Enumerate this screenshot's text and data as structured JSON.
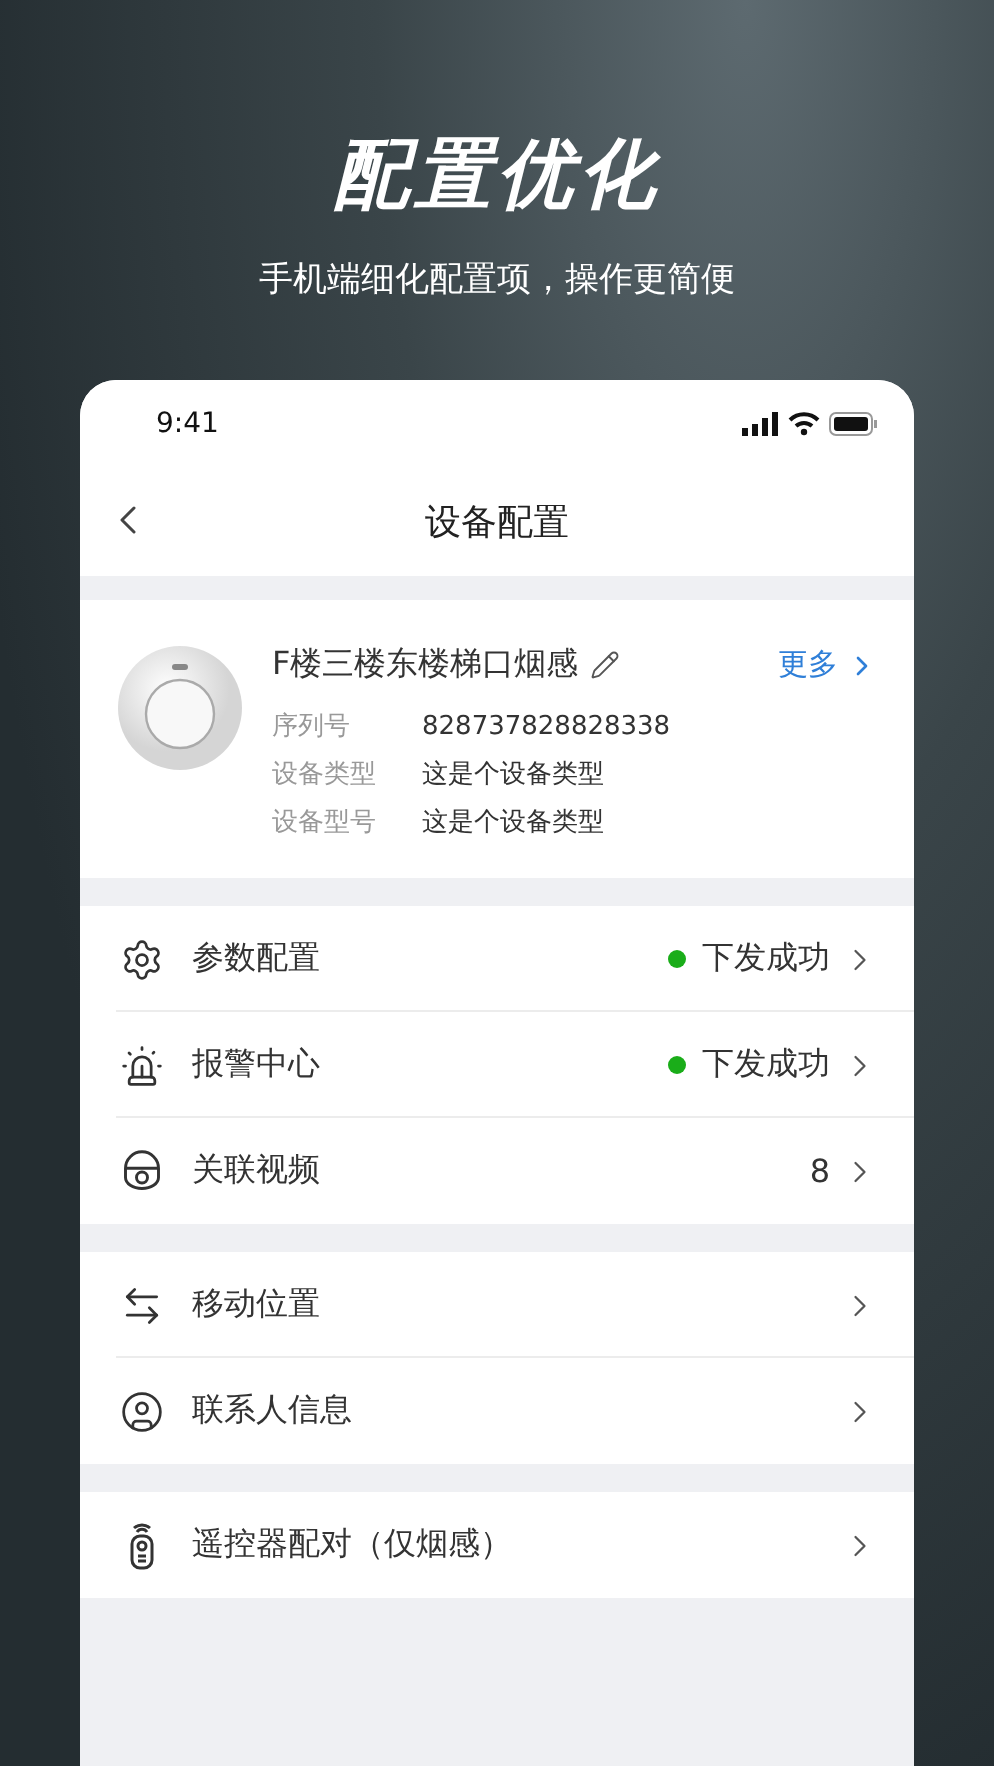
{
  "headline": "配置优化",
  "subtitle": "手机端细化配置项，操作更简便",
  "status_bar": {
    "time": "9:41"
  },
  "nav": {
    "title": "设备配置"
  },
  "device": {
    "name": "F楼三楼东楼梯口烟感",
    "more": "更多",
    "fields": [
      {
        "label": "序列号",
        "value": "828737828828338"
      },
      {
        "label": "设备类型",
        "value": "这是个设备类型"
      },
      {
        "label": "设备型号",
        "value": "这是个设备类型"
      }
    ]
  },
  "groups": [
    {
      "items": [
        {
          "kind": "gear",
          "label": "参数配置",
          "status": "下发成功",
          "color": "#1aad19"
        },
        {
          "kind": "alarm",
          "label": "报警中心",
          "status": "下发成功",
          "color": "#1aad19"
        },
        {
          "kind": "camera",
          "label": "关联视频",
          "count": "8"
        }
      ]
    },
    {
      "items": [
        {
          "kind": "swap",
          "label": "移动位置"
        },
        {
          "kind": "person",
          "label": "联系人信息"
        }
      ]
    },
    {
      "items": [
        {
          "kind": "remote",
          "label": "遥控器配对（仅烟感）"
        }
      ]
    }
  ]
}
